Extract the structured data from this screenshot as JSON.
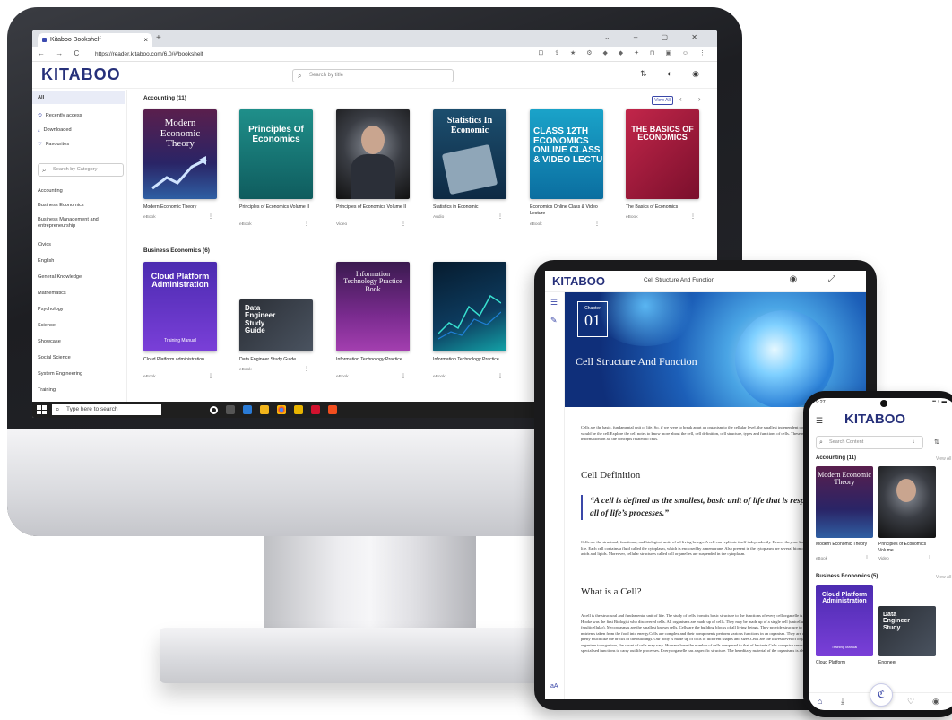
{
  "monitor": {
    "browser": {
      "tab_title": "Kitaboo Bookshelf",
      "tab_close": "×",
      "new_tab": "+",
      "window_controls": "⌄ – ▢ ✕",
      "nav_buttons": "← → C",
      "url": "https://reader.kitaboo.com/6.0/#/bookshelf",
      "extension_icons": "⊡ ⇪ ★ ⚙ ◆ ◆ ✦ ⊓ ▣ ☺ ⋮"
    },
    "app": {
      "logo": "KITABOO",
      "search_placeholder": "Search by title",
      "header_icons": "⇅ ◐ ◉"
    },
    "sidebar": {
      "items": [
        {
          "label": "All"
        },
        {
          "label": "Recently access",
          "icon": "⟲"
        },
        {
          "label": "Downloaded",
          "icon": "⤓"
        },
        {
          "label": "Favourites",
          "icon": "♡"
        }
      ],
      "category_search_placeholder": "Search by Category",
      "categories": [
        "Accounting",
        "Business Economics",
        "Business Management and entrepreneurship",
        "Civics",
        "English",
        "General Knowledge",
        "Mathematics",
        "Psychology",
        "Science",
        "Showcase",
        "Social Science",
        "System Engineering",
        "Training"
      ]
    },
    "sections": [
      {
        "title": "Accounting (11)",
        "view_all": "View All",
        "pager": "‹ ›",
        "books": [
          {
            "cover_text": "Modern Economic Theory",
            "title": "Modern Economic Theory",
            "type": "eBook"
          },
          {
            "cover_text": "Principles Of Economics",
            "title": "Principles of Economics Volume II",
            "type": "eBook"
          },
          {
            "cover_text": "",
            "title": "Principles of Economics Volume II",
            "type": "Video"
          },
          {
            "cover_text": "Statistics In Economic",
            "title": "Statistics in Economic",
            "type": "Audio"
          },
          {
            "cover_text": "CLASS 12TH ECONOMICS ONLINE CLASS & VIDEO LECTU",
            "title": "Economics Online Class & Video Lecture",
            "type": "eBook"
          },
          {
            "cover_text": "THE BASICS OF ECONOMICS",
            "title": "The Basics of Economics",
            "type": "eBook"
          }
        ]
      },
      {
        "title": "Business Economics (6)",
        "books": [
          {
            "cover_text": "Cloud Platform Administration",
            "cover_sub": "Training Manual",
            "title": "Cloud Platform administration",
            "type": "eBook"
          },
          {
            "cover_text": "Data Engineer Study Guide",
            "title": "Data Engineer Study Guide",
            "type": "eBook"
          },
          {
            "cover_text": "Information Technology Practice Book",
            "title": "Information Technology Practice ...",
            "type": "eBook"
          },
          {
            "cover_text": "",
            "title": "Information Technology Practice ...",
            "type": "eBook"
          }
        ]
      }
    ],
    "taskbar": {
      "search_placeholder": "Type here to search"
    }
  },
  "tablet": {
    "logo": "KITABOO",
    "title": "Cell Structure And Function",
    "chapter_label": "Chapter",
    "chapter_number": "01",
    "hero_title": "Cell Structure And Function",
    "intro": "Cells are the basic, fundamental unit of life. So, if we were to break apart an organism to the cellular level, the smallest independent component that we would find would be the cell.Explore the cell notes to know more about the cell, cell definition, cell structure, types and functions of cells. These notes have an in-depth information on all the concepts related to cells.",
    "h_definition": "Cell Definition",
    "quote": "“A cell is defined as the smallest, basic unit of life that is responsible for all of life’s processes.”",
    "definition_text": "Cells are the structural, functional, and biological units of all living beings. A cell can replicate itself independently. Hence, they are known as the building blocks of life. Each cell contains a fluid called the cytoplasm, which is enclosed by a membrane. Also present in the cytoplasm are several biomolecules like proteins, nucleic acids and lipids. Moreover, cellular structures called cell organelles are suspended in the cytoplasm.",
    "h_what": "What is a Cell?",
    "what_text": "A cell is the structural and fundamental unit of life. The study of cells from its basic structure to the functions of every cell organelle is called Cell Biology. Robert Hooke was the first Biologist who discovered cells. All organisms are made up of cells. They may be made up of a single cell (unicellular), or many cells (multicellular). Mycoplasmas are the smallest known cells. Cells are the building blocks of all living beings. They provide structure to the body and convert the nutrients taken from the food into energy.Cells are complex and their components perform various functions in an organism. They are of different shapes and sizes, pretty much like the bricks of the buildings. Our body is made up of cells of different shapes and sizes.Cells are the lowest level of organisation in every life form. From organism to organism, the count of cells may vary. Humans have the number of cells compared to that of bacteria.Cells comprise several cell organelles that perform specialised functions to carry out life processes. Every organelle has a specific structure. The hereditary material of the organisms is also present in the cells."
  },
  "phone": {
    "time": "9:27",
    "status_icons": "▪▪ ◗ ▬",
    "logo": "KITABOO",
    "search_placeholder": "Search Content",
    "section1": "Accounting (11)",
    "section2": "Business Economics (5)",
    "view_all": "View All",
    "books1": [
      {
        "cover_text": "Modern Economic Theory",
        "title": "Modern Economic Theory",
        "type": "eBook"
      },
      {
        "cover_text": "",
        "title": "Principles of Economics Volume",
        "type": "Video"
      }
    ],
    "books2": [
      {
        "cover_text": "Cloud Platform Administration",
        "cover_sub": "Training Manual",
        "title": "Cloud Platform",
        "type": ""
      },
      {
        "cover_text": "Data Engineer Study",
        "title": "Engineer",
        "type": ""
      }
    ]
  }
}
